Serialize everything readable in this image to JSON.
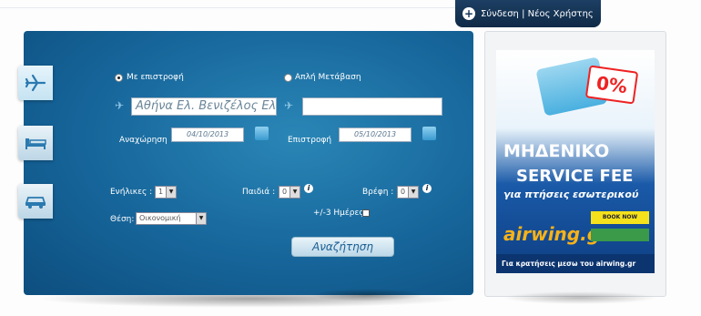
{
  "header": {
    "login_label": "Σύνδεση | Νέος Χρήστης"
  },
  "tabs": [
    {
      "name": "flights",
      "icon": "airplane-icon"
    },
    {
      "name": "hotels",
      "icon": "bed-icon"
    },
    {
      "name": "cars",
      "icon": "car-icon"
    }
  ],
  "form": {
    "trip_type": {
      "round_trip_label": "Με επιστροφή",
      "one_way_label": "Απλή Μετάβαση",
      "selected": "round_trip"
    },
    "from_value": "Αθήνα Ελ. Βενιζέλος Ελ",
    "to_value": "",
    "departure_label": "Αναχώρηση",
    "departure_value": "04/10/2013",
    "return_label": "Επιστροφή",
    "return_value": "05/10/2013",
    "adults_label": "Ενήλικες :",
    "adults_value": "1",
    "children_label": "Παιδιά :",
    "children_value": "0",
    "infants_label": "Βρέφη :",
    "infants_value": "0",
    "class_label": "Θέση:",
    "class_value": "Οικονομική",
    "flex_days_label": "+/-3 Ημέρες",
    "search_label": "Αναζήτηση"
  },
  "ad": {
    "percent": "0%",
    "headline1": "ΜΗΔΕΝΙΚΟ",
    "headline2": "SERVICE FEE",
    "headline3": "για πτήσεις εσωτερικού",
    "logo": "airwing.gr",
    "book_now": "BOOK NOW",
    "footer": "Για κρατήσεις μεσω του airwing.gr"
  },
  "colors": {
    "panel": "#16659a",
    "accent_text": "#1b5f94",
    "ad_blue": "#0e3f84"
  }
}
